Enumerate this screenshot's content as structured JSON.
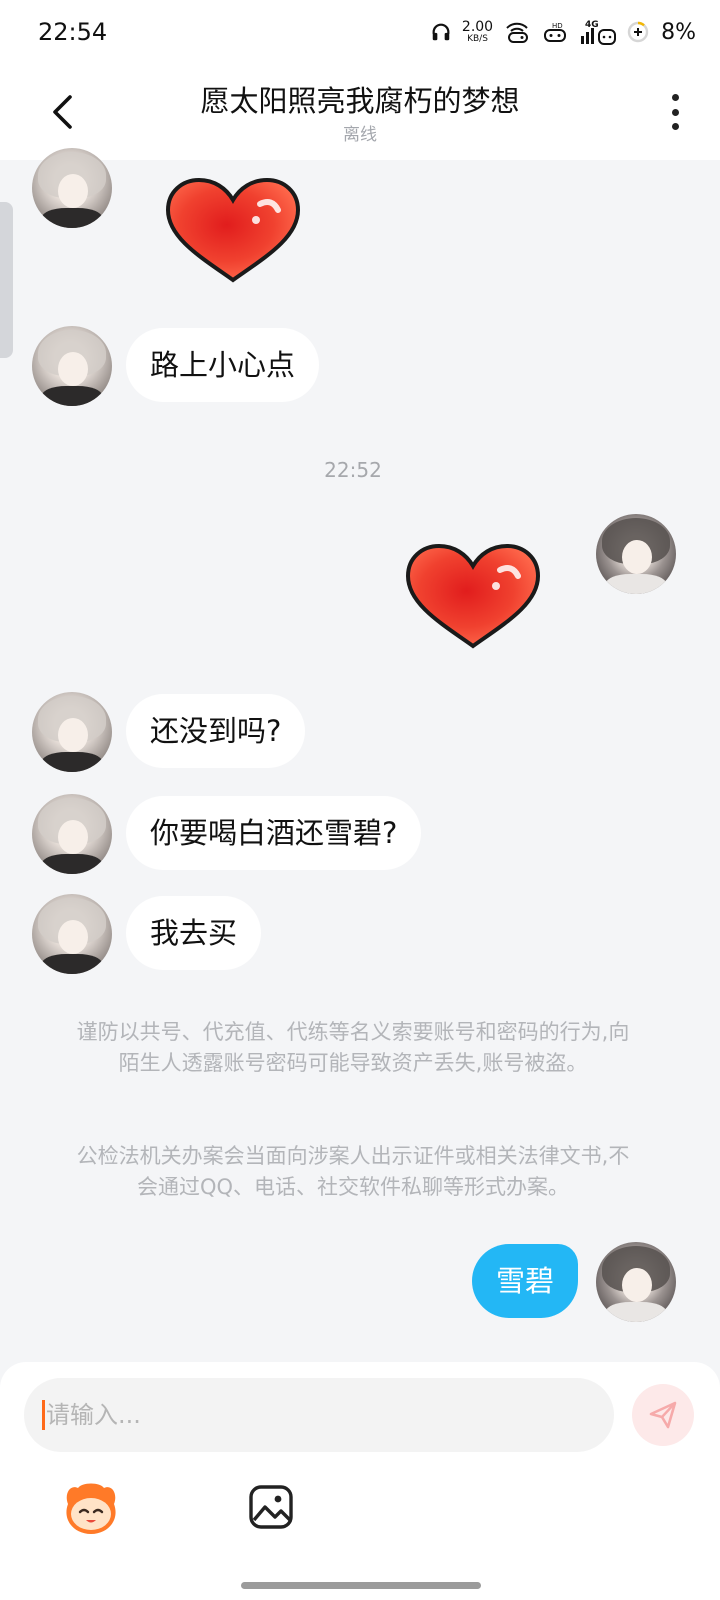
{
  "status_bar": {
    "time": "22:54",
    "net_speed": "2.00",
    "net_unit": "KB/S",
    "network": "4G",
    "battery": "8%"
  },
  "header": {
    "title": "愿太阳照亮我腐朽的梦想",
    "status": "离线"
  },
  "messages": [
    {
      "side": "left",
      "kind": "sticker",
      "sticker": "red-heart"
    },
    {
      "side": "left",
      "kind": "text",
      "text": "路上小心点"
    },
    {
      "kind": "time",
      "text": "22:52"
    },
    {
      "side": "right",
      "kind": "sticker",
      "sticker": "red-heart"
    },
    {
      "side": "left",
      "kind": "text",
      "text": "还没到吗?"
    },
    {
      "side": "left",
      "kind": "text",
      "text": "你要喝白酒还雪碧?"
    },
    {
      "side": "left",
      "kind": "text",
      "text": "我去买"
    },
    {
      "side": "right",
      "kind": "text",
      "text": "雪碧"
    }
  ],
  "notices": [
    "谨防以共号、代充值、代练等名义索要账号和密码的行为,向陌生人透露账号密码可能导致资产丢失,账号被盗。",
    "公检法机关办案会当面向涉案人出示证件或相关法律文书,不会通过QQ、电话、社交软件私聊等形式办案。"
  ],
  "input": {
    "placeholder": "请输入..."
  },
  "colors": {
    "my_bubble": "#23b7f5",
    "caret": "#ff6a1a",
    "send_button_bg": "#fde9e9"
  }
}
